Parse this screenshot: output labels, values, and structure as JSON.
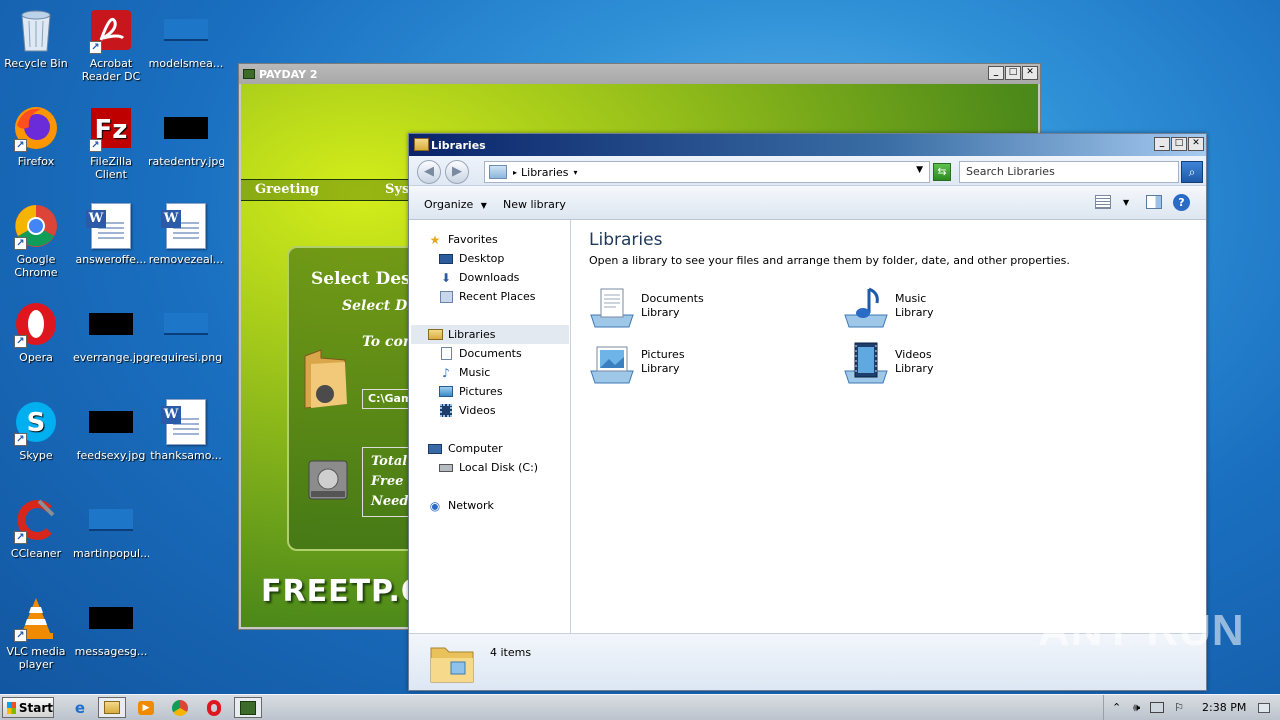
{
  "desktop": {
    "icons": [
      {
        "label": "Recycle Bin",
        "icon": "recycle-bin-icon"
      },
      {
        "label": "Acrobat Reader DC",
        "icon": "acrobat-icon"
      },
      {
        "label": "modelsmea...",
        "icon": "blank-file-icon"
      },
      {
        "label": "Firefox",
        "icon": "firefox-icon"
      },
      {
        "label": "FileZilla Client",
        "icon": "filezilla-icon"
      },
      {
        "label": "ratedentry.jpg",
        "icon": "image-thumb-icon"
      },
      {
        "label": "Google Chrome",
        "icon": "chrome-icon"
      },
      {
        "label": "answeroffe...",
        "icon": "word-doc-icon"
      },
      {
        "label": "removezeal...",
        "icon": "word-doc-icon"
      },
      {
        "label": "Opera",
        "icon": "opera-icon"
      },
      {
        "label": "everrange.jpg",
        "icon": "image-thumb-icon"
      },
      {
        "label": "requiresi.png",
        "icon": "blank-file-icon"
      },
      {
        "label": "Skype",
        "icon": "skype-icon"
      },
      {
        "label": "feedsexy.jpg",
        "icon": "image-thumb-icon"
      },
      {
        "label": "thanksamo...",
        "icon": "word-doc-icon"
      },
      {
        "label": "CCleaner",
        "icon": "ccleaner-icon"
      },
      {
        "label": "martinpopul...",
        "icon": "blank-file-icon"
      },
      {
        "label": "VLC media player",
        "icon": "vlc-icon"
      },
      {
        "label": "messagesg...",
        "icon": "image-thumb-icon"
      }
    ]
  },
  "payday": {
    "title": "PAYDAY 2",
    "menu": [
      "Greeting",
      "Sys"
    ],
    "heading": "Select Dest",
    "subheading": "Select Dir",
    "line": "To con",
    "path": "C:\\Gam",
    "space": [
      "Total",
      "Free S",
      "Need S"
    ],
    "brand": "FREETP.OR"
  },
  "explorer": {
    "title": "Libraries",
    "address": "Libraries",
    "search_placeholder": "Search Libraries",
    "organize": "Organize",
    "new_library": "New library",
    "nav": {
      "favorites": "Favorites",
      "desktop": "Desktop",
      "downloads": "Downloads",
      "recent": "Recent Places",
      "libraries": "Libraries",
      "documents": "Documents",
      "music": "Music",
      "pictures": "Pictures",
      "videos": "Videos",
      "computer": "Computer",
      "local_disk": "Local Disk (C:)",
      "network": "Network"
    },
    "heading": "Libraries",
    "description": "Open a library to see your files and arrange them by folder, date, and other properties.",
    "libraries": [
      {
        "name": "Documents",
        "type": "Library"
      },
      {
        "name": "Music",
        "type": "Library"
      },
      {
        "name": "Pictures",
        "type": "Library"
      },
      {
        "name": "Videos",
        "type": "Library"
      }
    ],
    "item_count": "4 items"
  },
  "taskbar": {
    "start": "Start",
    "clock": "2:38 PM"
  },
  "watermark": "ANY RUN"
}
